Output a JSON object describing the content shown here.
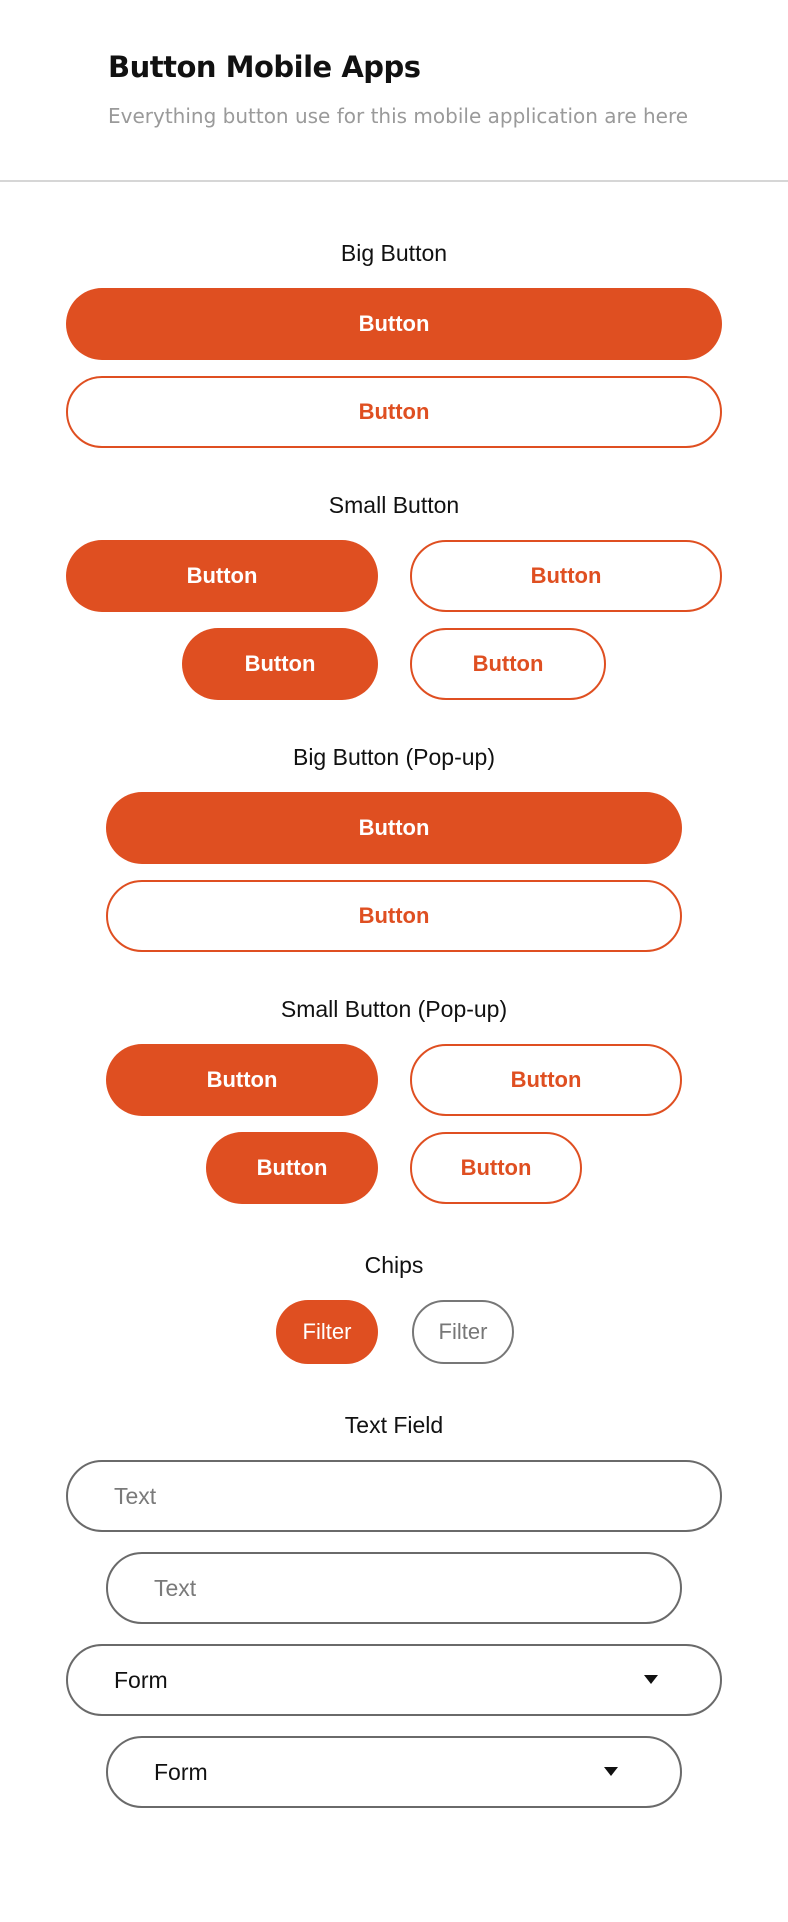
{
  "header": {
    "title": "Button Mobile Apps",
    "subtitle": "Everything button use for this mobile application are here"
  },
  "sections": {
    "big_button": "Big Button",
    "small_button": "Small Button",
    "big_button_popup": "Big Button (Pop-up)",
    "small_button_popup": "Small Button (Pop-up)",
    "chips": "Chips",
    "text_field": "Text Field"
  },
  "buttons": {
    "label": "Button"
  },
  "chips": {
    "filter_label": "Filter"
  },
  "text_field": {
    "placeholder": "Text",
    "form_value": "Form"
  },
  "colors": {
    "accent": "#df4f21",
    "outline_gray": "#6a6a6a",
    "subtitle_gray": "#9a9a9a"
  },
  "icons": {
    "dropdown": "caret-down-icon"
  }
}
